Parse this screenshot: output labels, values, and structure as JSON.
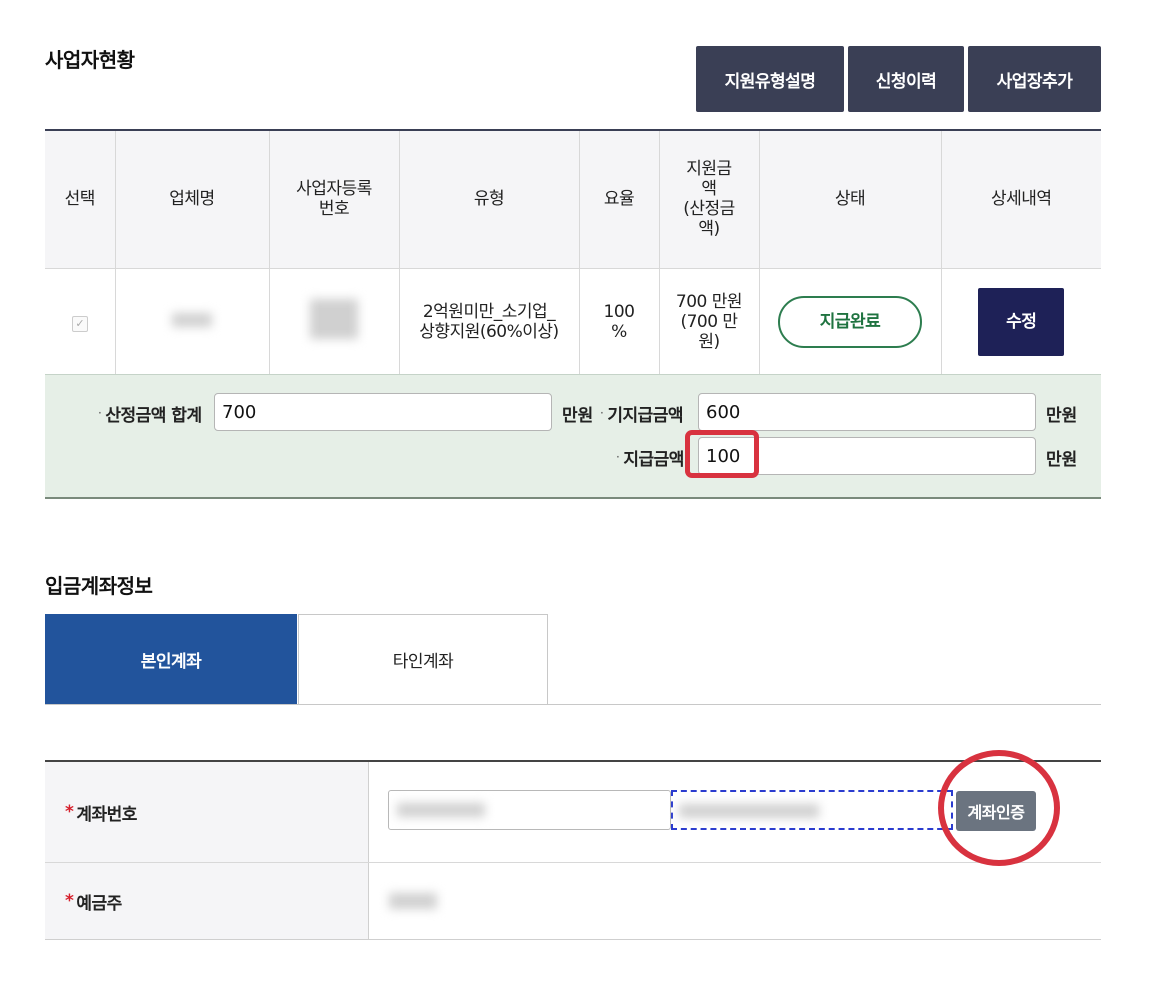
{
  "business": {
    "title": "사업자현황",
    "buttons": {
      "support_type": "지원유형설명",
      "history": "신청이력",
      "add_site": "사업장추가"
    },
    "columns": [
      "선택",
      "업체명",
      "사업자등록\n번호",
      "유형",
      "요율",
      "지원금\n액\n(산정금\n액)",
      "상태",
      "상세내역"
    ],
    "row": {
      "type": "2억원미만_소기업_\n상향지원(60%이상)",
      "rate": "100\n%",
      "amount": "700 만원\n(700 만\n원)",
      "status": "지급완료",
      "action": "수정"
    }
  },
  "summary": {
    "total_label": "산정금액 합계",
    "total_value": "700",
    "total_unit": "만원",
    "paid_label": "기지급금액",
    "paid_value": "600",
    "paid_unit": "만원",
    "pay_label": "지급금액",
    "pay_value": "100",
    "pay_unit": "만원"
  },
  "account": {
    "title": "입금계좌정보",
    "tabs": {
      "own": "본인계좌",
      "other": "타인계좌"
    },
    "number_label": "계좌번호",
    "holder_label": "예금주",
    "verify_button": "계좌인증",
    "required_mark": "*"
  },
  "colors": {
    "button_dark": "#3a3f55",
    "tab_active": "#22549c",
    "status_green": "#1f7340",
    "edit_navy": "#1e2157",
    "summary_bg": "#e6efe7",
    "highlight_red": "#d8323f"
  }
}
